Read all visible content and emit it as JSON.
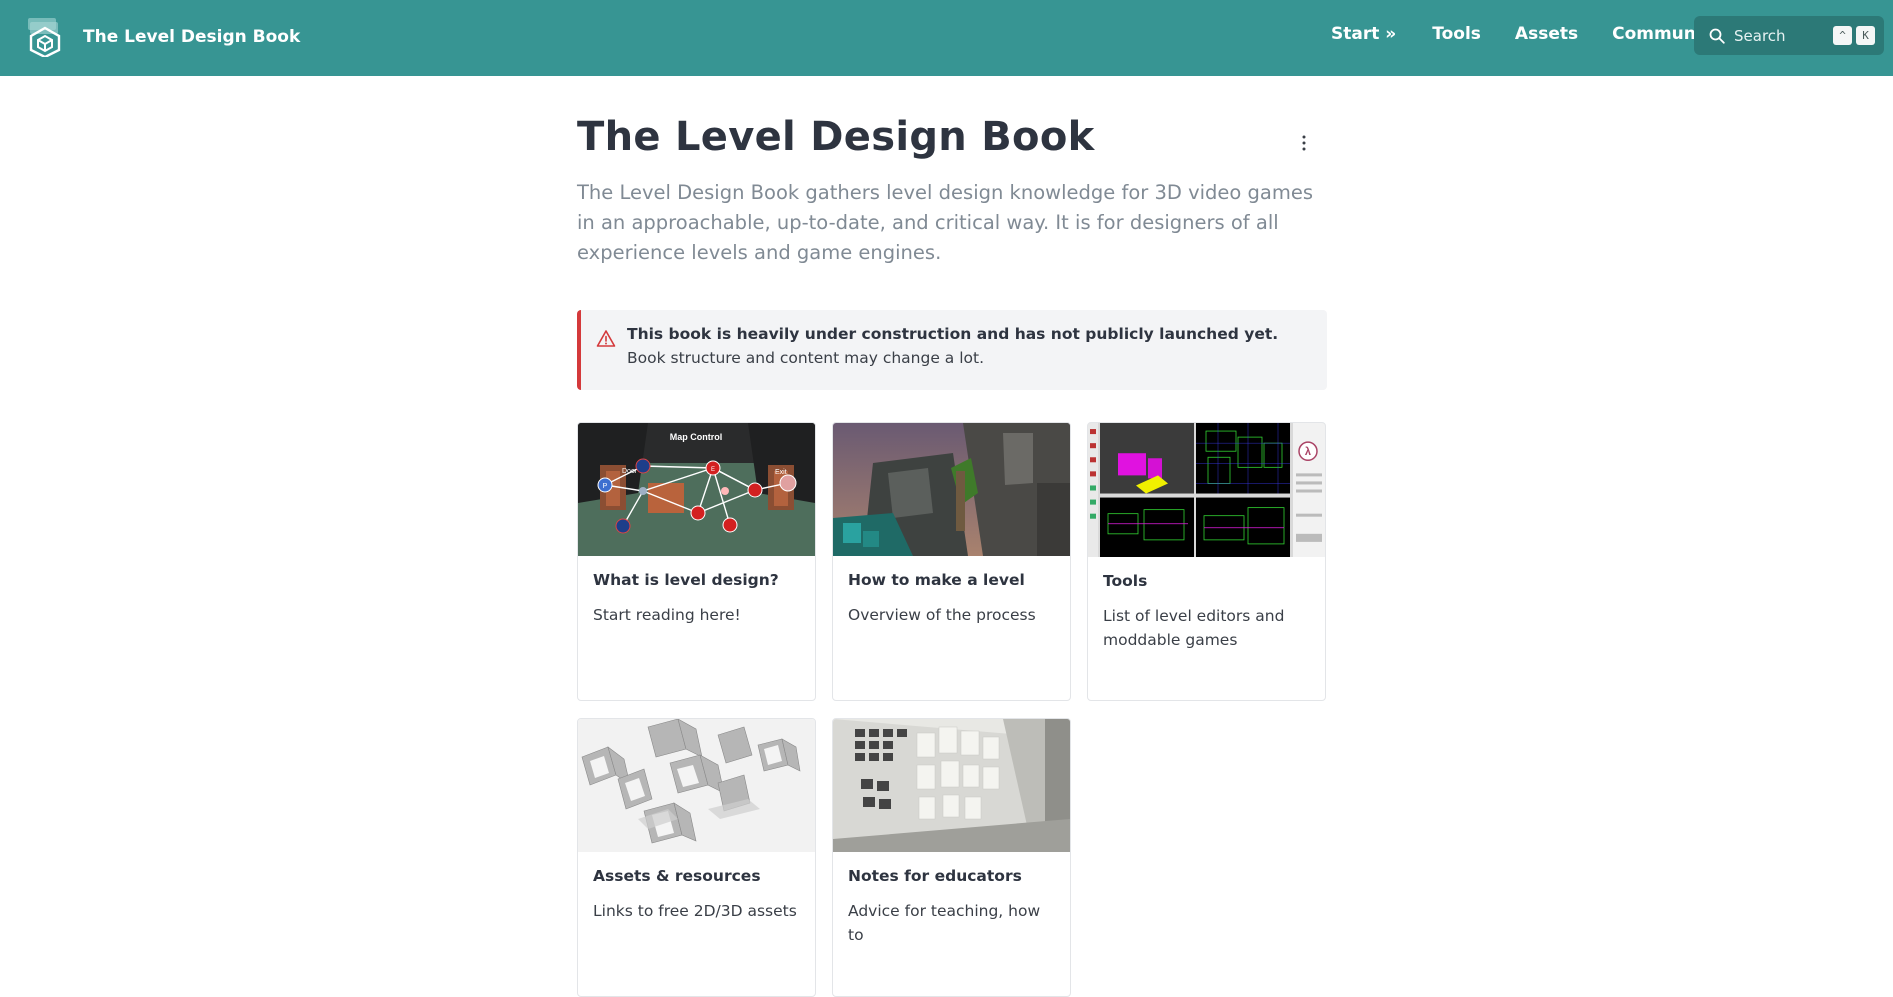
{
  "header": {
    "site_title": "The Level Design Book",
    "nav": [
      "Start »",
      "Tools",
      "Assets",
      "Community"
    ],
    "search_placeholder": "Search",
    "shortcut_keys": [
      "^",
      "K"
    ]
  },
  "page": {
    "title": "The Level Design Book",
    "lead": "The Level Design Book gathers level design knowledge for 3D video games in an approachable, up-to-date, and critical way. It is for designers of all experience levels and game engines.",
    "callout_bold": "This book is heavily under construction and has not publicly launched yet.",
    "callout_rest": " Book structure and content may change a lot."
  },
  "cards": [
    {
      "title": "What is level design?",
      "desc": "Start reading here!",
      "image_labels": [
        "Map Control",
        "Door",
        "Exit",
        "P",
        "E"
      ]
    },
    {
      "title": "How to make a level",
      "desc": "Overview of the process"
    },
    {
      "title": "Tools",
      "desc": "List of level editors and moddable games"
    },
    {
      "title": "Assets & resources",
      "desc": "Links to free 2D/3D assets"
    },
    {
      "title": "Notes for educators",
      "desc": "Advice for teaching, how to"
    }
  ],
  "colors": {
    "topbar": "#379593",
    "search_bg": "#2c7977",
    "callout_border": "#d4393b",
    "callout_bg": "#f3f4f6"
  },
  "icons": [
    "book-logo-icon",
    "search-icon",
    "more-vertical-icon",
    "warning-icon"
  ]
}
